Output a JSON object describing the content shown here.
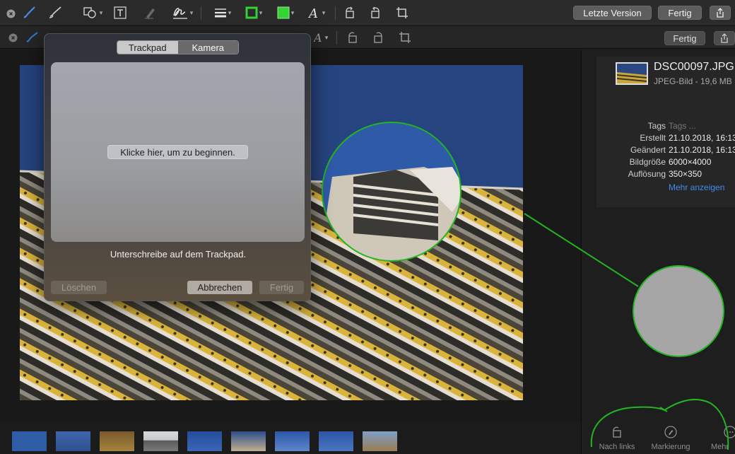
{
  "toolbar": {
    "icons": [
      "sketch-icon",
      "draw-icon",
      "shapes-icon",
      "text-icon",
      "highlight-icon",
      "signature-icon",
      "line-style-icon",
      "border-color-icon",
      "fill-color-icon",
      "font-icon",
      "rotate-left-icon",
      "rotate-right-icon",
      "crop-icon"
    ],
    "border_color": "#33d433",
    "fill_color": "#33d433",
    "latest_version_label": "Letzte Version",
    "done_label": "Fertig",
    "share_icon": "share-icon"
  },
  "toolbar2": {
    "done_label": "Fertig"
  },
  "signature_popover": {
    "tabs": [
      {
        "label": "Trackpad",
        "active": true
      },
      {
        "label": "Kamera",
        "active": false
      }
    ],
    "start_button": "Klicke hier, um zu beginnen.",
    "hint": "Unterschreibe auf dem Trackpad.",
    "clear_label": "Löschen",
    "cancel_label": "Abbrechen",
    "done_label": "Fertig"
  },
  "info": {
    "filename": "DSC00097.JPG",
    "filetype": "JPEG-Bild - 19,6 MB",
    "rows": [
      {
        "key": "Tags",
        "value": "Tags ..."
      },
      {
        "key": "Erstellt",
        "value": "21.10.2018, 16:13"
      },
      {
        "key": "Geändert",
        "value": "21.10.2018, 16:13"
      },
      {
        "key": "Bildgröße",
        "value": "6000×4000"
      },
      {
        "key": "Auflösung",
        "value": "350×350"
      }
    ],
    "more_label": "Mehr anzeigen"
  },
  "actions": [
    {
      "label": "Nach links",
      "icon": "rotate-left-icon"
    },
    {
      "label": "Markierung",
      "icon": "markup-icon"
    },
    {
      "label": "Mehr",
      "icon": "more-icon"
    }
  ],
  "annotation_color": "#22b422",
  "magnifier_fill": "#a6a6a6"
}
